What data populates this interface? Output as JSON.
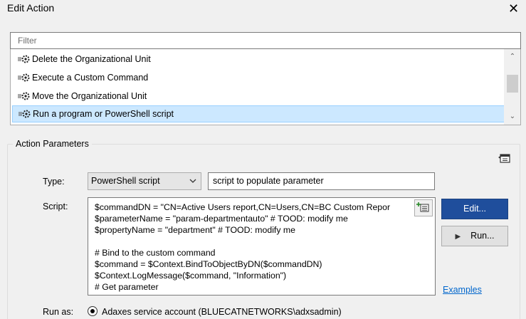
{
  "window": {
    "title": "Edit Action",
    "close_glyph": "✕"
  },
  "filter": {
    "placeholder": "Filter",
    "value": ""
  },
  "actions": {
    "items": [
      {
        "label": "Delete the Organizational Unit",
        "icon": "gear-action-icon"
      },
      {
        "label": "Execute a Custom Command",
        "icon": "gear-action-icon"
      },
      {
        "label": "Move the Organizational Unit",
        "icon": "gear-action-icon"
      },
      {
        "label": "Run a program or PowerShell script",
        "icon": "gear-action-icon",
        "selected": true
      }
    ],
    "scroll_up_glyph": "⌃",
    "scroll_down_glyph": "⌄"
  },
  "params": {
    "group_label": "Action Parameters",
    "type_label": "Type:",
    "type_value": "PowerShell script",
    "description_value": "script to populate parameter",
    "script_label": "Script:",
    "script_lines": [
      "$commandDN = \"CN=Active Users report,CN=Users,CN=BC Custom Repor",
      "$parameterName = \"param-departmentauto\" # TOOD: modify me",
      "$propertyName = \"department\" # TOOD: modify me",
      "",
      "# Bind to the custom command",
      "$command = $Context.BindToObjectByDN($commandDN)",
      "$Context.LogMessage($command, \"Information\")",
      "# Get parameter"
    ],
    "edit_button": "Edit...",
    "run_button": "Run...",
    "run_icon_glyph": "▶",
    "examples_link": "Examples",
    "run_as_label": "Run as:",
    "run_as_option": "Adaxes service account (BLUECATNETWORKS\\adxsadmin)"
  },
  "colors": {
    "selected_row": "#cce8ff",
    "primary_button": "#1f4e9c",
    "link": "#0066cc"
  }
}
